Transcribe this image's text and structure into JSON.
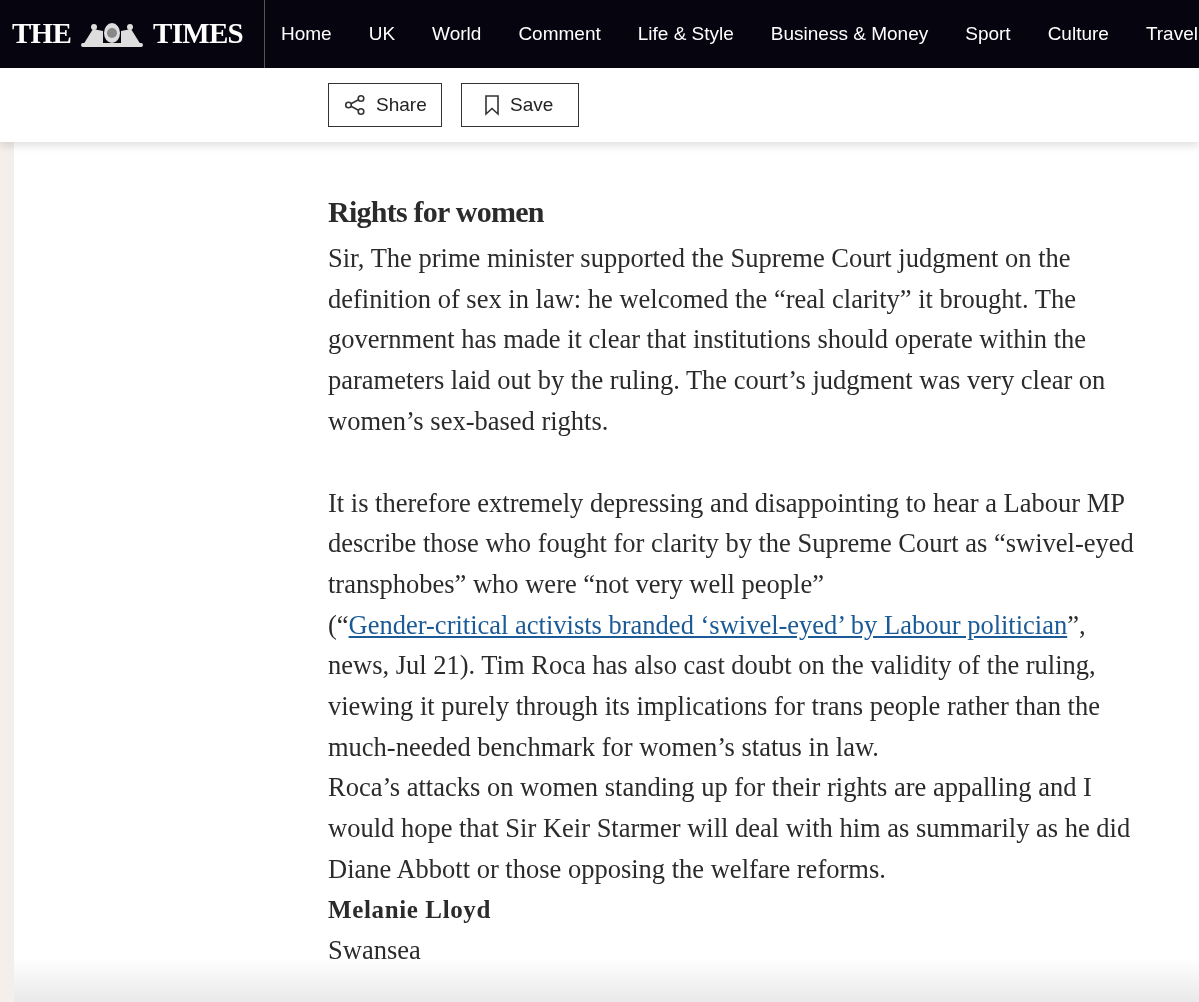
{
  "masthead": {
    "logo_left": "THE",
    "logo_right": "TIMES"
  },
  "nav": [
    "Home",
    "UK",
    "World",
    "Comment",
    "Life & Style",
    "Business & Money",
    "Sport",
    "Culture",
    "Travel"
  ],
  "toolbar": {
    "buttons": [
      {
        "kind": "share",
        "label": "Share"
      },
      {
        "kind": "save",
        "label": "Save"
      }
    ]
  },
  "article": {
    "heading": "Rights for women",
    "paragraphs": [
      {
        "blocks": [
          {
            "spans": [
              {
                "kind": "text",
                "text": "Sir, The prime minister supported the Supreme Court judgment on the definition of sex in law: he welcomed the “real clarity” it brought. The government has made it clear that institutions should operate within the parameters laid out by the ruling. The court’s judgment was very clear on women’s sex-based rights."
              }
            ]
          }
        ]
      },
      {
        "blocks": [
          {
            "spans": [
              {
                "kind": "text",
                "text": "It is therefore extremely depressing and disappointing to hear a Labour MP describe those who fought for clarity by the Supreme Court as “swivel-eyed transphobes” who were “not very well people” (“"
              },
              {
                "kind": "link",
                "text": "Gender-critical activists branded ‘swivel-eyed’ by Labour politician"
              },
              {
                "kind": "text",
                "text": "”, news, Jul 21). Tim Roca has also cast doubt on the validity of the ruling, viewing it purely through its implications for trans people rather than the much-needed benchmark for women’s status in law."
              }
            ]
          },
          {
            "spans": [
              {
                "kind": "text",
                "text": "Roca’s attacks on women standing up for their rights are appalling and I would hope that Sir Keir Starmer will deal with him as summarily as he did Diane Abbott or those opposing the welfare reforms."
              }
            ]
          }
        ]
      }
    ],
    "signature": {
      "name": "Melanie Lloyd",
      "place": "Swansea"
    }
  }
}
